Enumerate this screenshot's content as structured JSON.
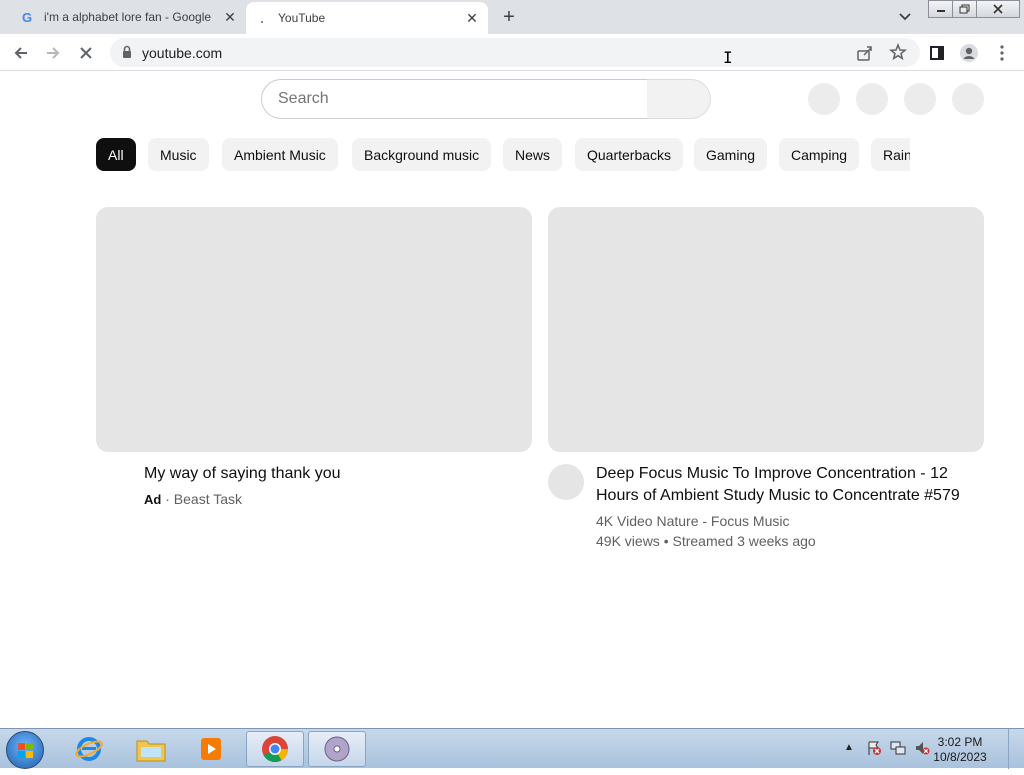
{
  "browser": {
    "tabs": [
      {
        "favicon": "google-icon",
        "title": "i'm a alphabet lore fan - Google",
        "active": false
      },
      {
        "favicon": "loading-icon",
        "title": "YouTube",
        "active": true
      }
    ],
    "address": "youtube.com"
  },
  "youtube": {
    "search_placeholder": "Search",
    "chips": [
      {
        "label": "All",
        "active": true
      },
      {
        "label": "Music",
        "active": false
      },
      {
        "label": "Ambient Music",
        "active": false
      },
      {
        "label": "Background music",
        "active": false
      },
      {
        "label": "News",
        "active": false
      },
      {
        "label": "Quarterbacks",
        "active": false
      },
      {
        "label": "Gaming",
        "active": false
      },
      {
        "label": "Camping",
        "active": false
      },
      {
        "label": "Rain",
        "active": false
      }
    ],
    "videos": [
      {
        "title": "My way of saying thank you",
        "ad_label": "Ad",
        "separator": "·",
        "channel": "Beast Task"
      },
      {
        "title_line1": "Deep Focus Music To Improve Concentration - 12",
        "title_line2": "Hours of Ambient Study Music to Concentrate #579",
        "channel": "4K Video Nature - Focus Music",
        "stats": "49K views • Streamed 3 weeks ago"
      }
    ]
  },
  "taskbar": {
    "time": "3:02 PM",
    "date": "10/8/2023"
  },
  "colors": {
    "chip_active_bg": "#0f0f0f",
    "chip_bg": "#f2f2f2",
    "skeleton": "#e5e5e5"
  }
}
